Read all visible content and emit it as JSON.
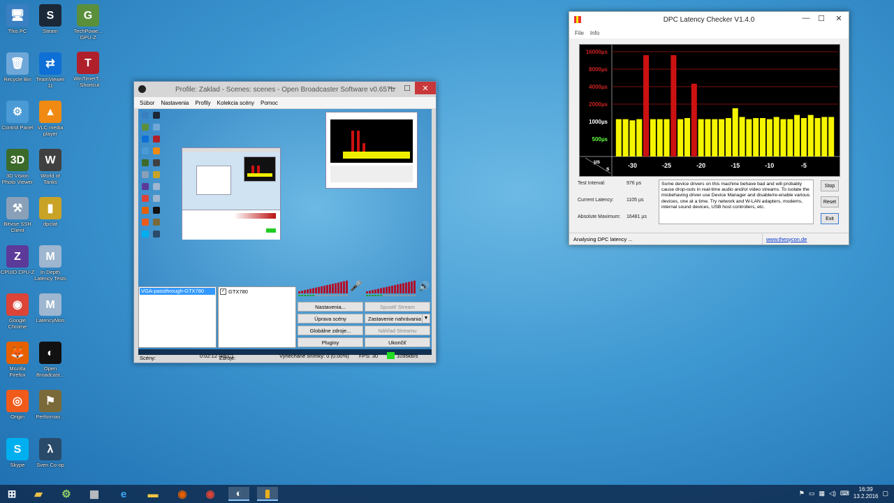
{
  "desktop_icons": [
    {
      "name": "this-pc",
      "label": "This PC",
      "color": "#3a7fc1",
      "glyph": "🖥"
    },
    {
      "name": "steam",
      "label": "Steam",
      "color": "#1b2838",
      "glyph": "S"
    },
    {
      "name": "techpowerup",
      "label": "TechPowe...\nGPU-Z",
      "color": "#5a8f3c",
      "glyph": "G"
    },
    {
      "name": "recycle-bin",
      "label": "Recycle Bin",
      "color": "#6fa8d8",
      "glyph": "🗑"
    },
    {
      "name": "teamviewer",
      "label": "TeamViewer\n11",
      "color": "#0e6fd6",
      "glyph": "⇄"
    },
    {
      "name": "wintimer",
      "label": "WinTimerT...\n- Shortcut",
      "color": "#b0202a",
      "glyph": "T"
    },
    {
      "name": "control-panel",
      "label": "Control Panel",
      "color": "#4a9ad6",
      "glyph": "⚙"
    },
    {
      "name": "vlc",
      "label": "VLC media\nplayer",
      "color": "#f08a12",
      "glyph": "▲"
    },
    {
      "name": "3d-vision",
      "label": "3D Vision\nPhoto Viewer",
      "color": "#3c6a2a",
      "glyph": "3D"
    },
    {
      "name": "world-of-tanks",
      "label": "World of\nTanks",
      "color": "#404040",
      "glyph": "W"
    },
    {
      "name": "bitvise",
      "label": "Bitvise SSH\nClient",
      "color": "#8aa0b8",
      "glyph": "⚒"
    },
    {
      "name": "dpclat",
      "label": "dpclat",
      "color": "#c9a326",
      "glyph": "▮"
    },
    {
      "name": "cpuid",
      "label": "CPUID CPU-Z",
      "color": "#5b3a9a",
      "glyph": "Z"
    },
    {
      "name": "in-depth-latency",
      "label": "In Depth\nLatency Tests",
      "color": "#9eb6cf",
      "glyph": "M"
    },
    {
      "name": "google-chrome",
      "label": "Google\nChrome",
      "color": "#db4437",
      "glyph": "◉"
    },
    {
      "name": "latencymon",
      "label": "LatencyMon",
      "color": "#9eb6cf",
      "glyph": "M"
    },
    {
      "name": "mozilla-firefox",
      "label": "Mozilla\nFirefox",
      "color": "#e66000",
      "glyph": "🦊"
    },
    {
      "name": "open-broadcaster",
      "label": "Open\nBroadcast...",
      "color": "#111111",
      "glyph": "◐"
    },
    {
      "name": "origin",
      "label": "Origin",
      "color": "#f05a1a",
      "glyph": "◎"
    },
    {
      "name": "performance",
      "label": "Performan...",
      "color": "#7a6a3a",
      "glyph": "⚑"
    },
    {
      "name": "skype",
      "label": "Skype",
      "color": "#00aff0",
      "glyph": "S"
    },
    {
      "name": "sven-coop",
      "label": "Sven Co-op",
      "color": "#2a4a6a",
      "glyph": "λ"
    }
  ],
  "obs": {
    "title": "Profile: Zaklad - Scenes: scenes - Open Broadcaster Software v0.657b",
    "menu": [
      "Súbor",
      "Nastavenia",
      "Profily",
      "Kolekcia scény",
      "Pomoc"
    ],
    "scenes_label": "Scény:",
    "sources_label": "Zdroje:",
    "scene_item": "VGA-passthrough-GTX780",
    "source_item": "GTX780",
    "buttons": {
      "settings": "Nastavenia...",
      "start_stream": "Spustiť Stream",
      "edit_scene": "Úprava scény",
      "stop_recording": "Zastavenie nahrávania",
      "global_sources": "Globálne zdroje...",
      "preview_stream": "Náhľad Streamu",
      "plugins": "Pluginy",
      "exit": "Ukončiť"
    },
    "status": {
      "time": "0:02:12 (REC)",
      "dropped": "Vynechané snímky: 0 (0.00%)",
      "fps": "FPS: 30",
      "bitrate": "1095kb/s"
    }
  },
  "dpc": {
    "title": "DPC Latency Checker V1.4.0",
    "menu": [
      "File",
      "Info"
    ],
    "labels": {
      "test_interval": "Test Interval:",
      "current_latency": "Current Latency:",
      "absolute_maximum": "Absolute Maximum:"
    },
    "values": {
      "test_interval": "976 µs",
      "current_latency": "1105 µs",
      "absolute_maximum": "16481 µs"
    },
    "description": "Some device drivers on this machine behave bad and will probably cause drop-outs in real-time audio and/or video streams. To isolate the misbehaving driver use Device Manager and disable/re-enable various devices, one at a time. Try network and W-LAN adapters, modems, internal sound devices, USB host controllers, etc.",
    "buttons": {
      "stop": "Stop",
      "reset": "Reset",
      "exit": "Exit"
    },
    "status": "Analysing DPC latency ...",
    "link": "www.thesycon.de"
  },
  "chart_data": {
    "type": "bar",
    "title": "",
    "y_tick_labels": [
      "16000µs",
      "8000µs",
      "4000µs",
      "2000µs",
      "1000µs",
      "500µs"
    ],
    "y_tick_colors": [
      "#cc2222",
      "#cc2222",
      "#cc2222",
      "#cc2222",
      "#ffffff",
      "#66ff44"
    ],
    "x_tick_labels": [
      "-30",
      "-25",
      "-20",
      "-15",
      "-10",
      "-5"
    ],
    "x_ticks": [
      -30,
      -25,
      -20,
      -15,
      -10,
      -5
    ],
    "corner_labels": {
      "y_unit": "µs",
      "x_unit": "s"
    },
    "x": [
      -32,
      -31,
      -30,
      -29,
      -28,
      -27,
      -26,
      -25,
      -24,
      -23,
      -22,
      -21,
      -20,
      -19,
      -18,
      -17,
      -16,
      -15,
      -14,
      -13,
      -12,
      -11,
      -10,
      -9,
      -8,
      -7,
      -6,
      -5,
      -4,
      -3,
      -2,
      -1
    ],
    "values": [
      1100,
      1100,
      1050,
      1100,
      14000,
      1100,
      1100,
      1100,
      14000,
      1100,
      1150,
      4500,
      1100,
      1100,
      1100,
      1100,
      1150,
      1700,
      1200,
      1100,
      1150,
      1150,
      1100,
      1200,
      1100,
      1100,
      1300,
      1150,
      1300,
      1150,
      1200,
      1200
    ],
    "high_threshold": 2000,
    "colors": {
      "normal": "#f5f500",
      "high": "#cc1111",
      "grid": "#7a1010",
      "background": "#000000"
    }
  },
  "taskbar": {
    "icons": [
      "start-icon",
      "file-explorer-icon",
      "settings-icon",
      "grid-app-icon",
      "internet-explorer-icon",
      "folder-icon",
      "firefox-icon",
      "chrome-icon",
      "obs-icon",
      "dpclat-icon"
    ],
    "time": "16:39",
    "date": "13.2.2016"
  }
}
